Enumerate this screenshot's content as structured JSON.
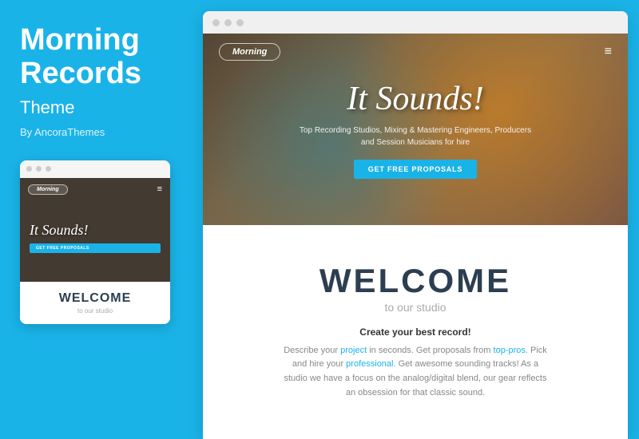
{
  "left": {
    "title_line1": "Morning",
    "title_line2": "Records",
    "subtitle": "Theme",
    "by_text": "By AncoraThemes"
  },
  "small_mockup": {
    "logo_text": "Morning",
    "hero_title": "It Sounds!",
    "btn_text": "GET FREE PROPOSALS",
    "welcome_title": "WELCOME",
    "welcome_sub": "to our studio"
  },
  "browser": {
    "dots": [
      "dot1",
      "dot2",
      "dot3"
    ]
  },
  "hero": {
    "logo_text": "Morning",
    "hamburger": "≡",
    "title": "It Sounds!",
    "description": "Top Recording Studios, Mixing & Mastering Engineers, Producers and Session Musicians for hire",
    "btn_text": "GET FREE PROPOSALS"
  },
  "welcome": {
    "title": "WELCOME",
    "subtitle": "to our studio",
    "tagline": "Create your best record!",
    "body_part1": "Describe your ",
    "link1": "project",
    "body_part2": " in seconds. Get proposals from ",
    "link2": "top-pros",
    "body_part3": ". Pick and hire your ",
    "link3": "professional",
    "body_part4": ". Get awesome sounding tracks! As a studio we have a focus on the analog/digital blend, our gear reflects an obsession for that classic sound."
  }
}
